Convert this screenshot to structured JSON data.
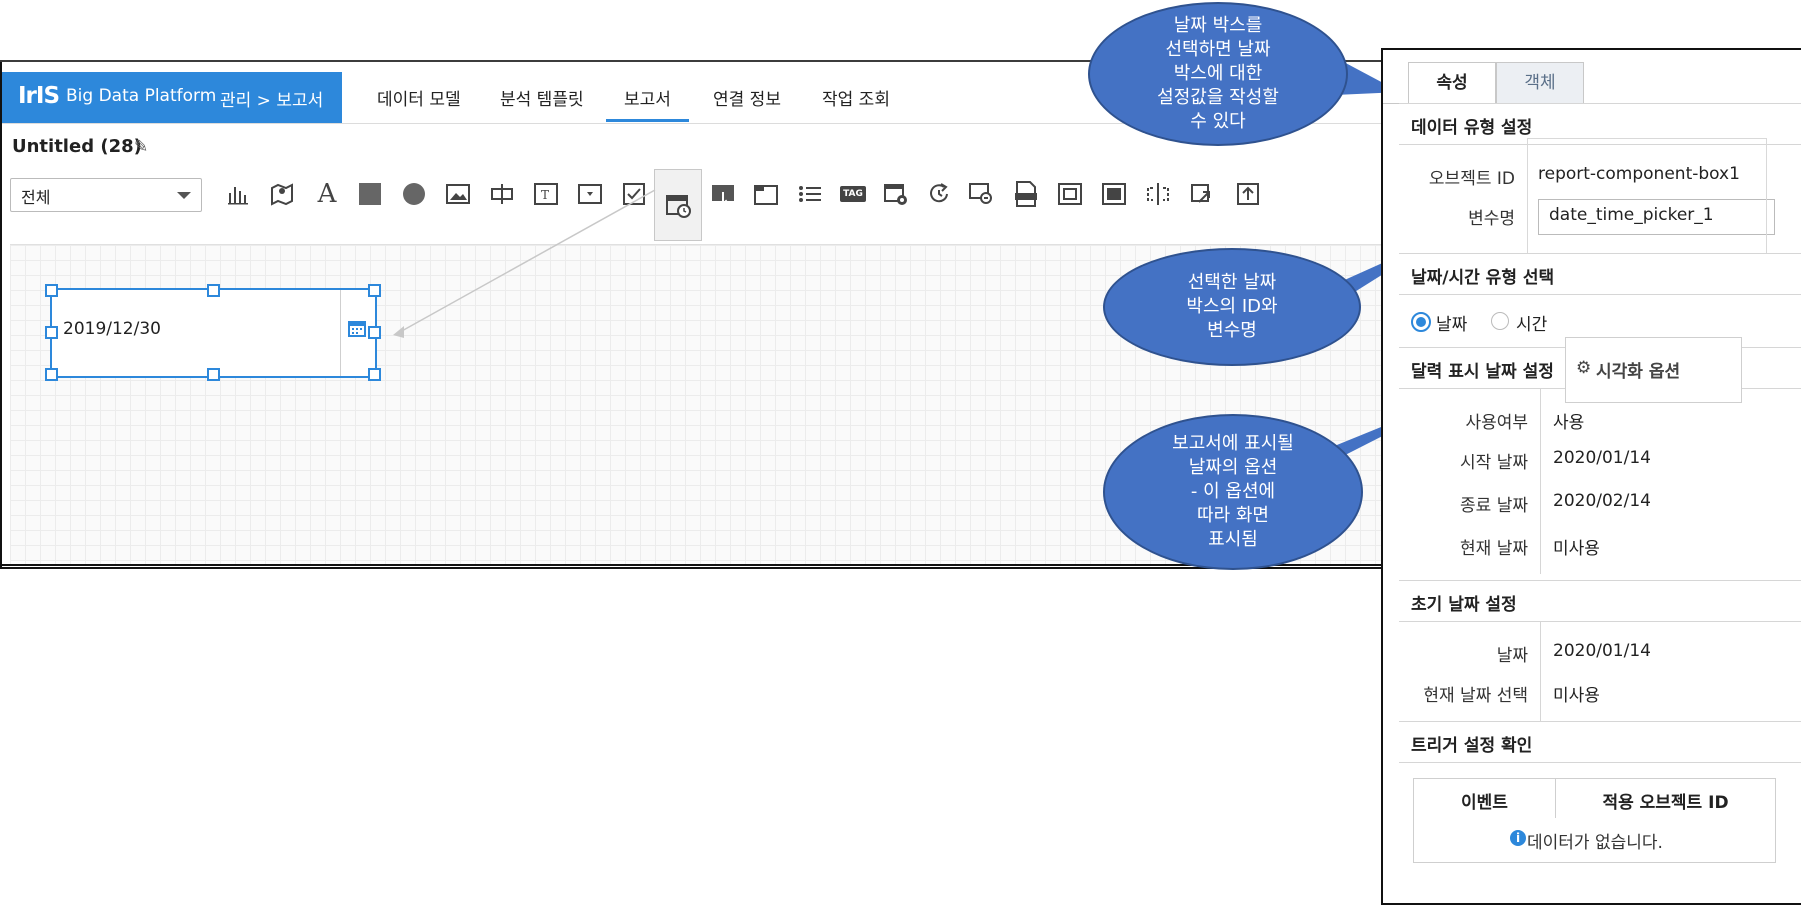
{
  "nav": {
    "logo": "IrIS",
    "product": "Big Data Platform",
    "breadcrumb": "관리 > 보고서",
    "tabs": [
      "데이터 모델",
      "분석 템플릿",
      "보고서",
      "연결 정보",
      "작업 조회"
    ],
    "active_tab": "보고서"
  },
  "document": {
    "title": "Untitled (28)"
  },
  "toolbar": {
    "filter_value": "전체",
    "icons": [
      "bar-chart-icon",
      "map-icon",
      "text-icon",
      "rectangle-icon",
      "circle-icon",
      "image-icon",
      "slider-icon",
      "textbox-icon",
      "dropdown-icon",
      "checkbox-icon",
      "date-picker-icon",
      "button-icon",
      "tabs-icon",
      "list-icon",
      "tag-icon",
      "calendar-settings-icon",
      "refresh-icon",
      "link-icon",
      "html-icon",
      "frame-icon",
      "panel-icon",
      "split-icon",
      "share-icon",
      "upload-icon"
    ],
    "tag_text": "TAG"
  },
  "component": {
    "date_value": "2019/12/30"
  },
  "panel": {
    "tabs": [
      "속성",
      "객체"
    ],
    "sec_data_type": "데이터 유형 설정",
    "object_id_label": "오브젝트 ID",
    "object_id_value": "report-component-box1",
    "var_label": "변수명",
    "var_value": "date_time_picker_1",
    "sec_datetime": "날짜/시간 유형 선택",
    "radio_date": "날짜",
    "radio_time": "시간",
    "sec_calendar": "달력 표시 날짜 설정",
    "vis_option": "시각화 옵션",
    "use_label": "사용여부",
    "use_value": "사용",
    "start_label": "시작 날짜",
    "start_value": "2020/01/14",
    "end_label": "종료 날짜",
    "end_value": "2020/02/14",
    "today_label": "현재 날짜",
    "today_value": "미사용",
    "sec_initial": "초기 날짜 설정",
    "init_date_label": "날짜",
    "init_date_value": "2020/01/14",
    "init_today_label": "현재 날짜 선택",
    "init_today_value": "미사용",
    "sec_trigger": "트리거 설정 확인",
    "trigger_col1": "이벤트",
    "trigger_col2": "적용 오브젝트 ID",
    "trigger_empty": "데이터가 없습니다."
  },
  "callouts": {
    "c1": "날짜 박스를\n선택하면 날짜\n박스에 대한\n설정값을 작성할\n수 있다",
    "c2": "선택한 날짜\n박스의 ID와\n변수명",
    "c3": "보고서에 표시될\n날짜의 옵션\n- 이 옵션에\n따라 화면\n표시됨"
  },
  "colors": {
    "brand": "#2d88db",
    "callout": "#4472c4"
  }
}
